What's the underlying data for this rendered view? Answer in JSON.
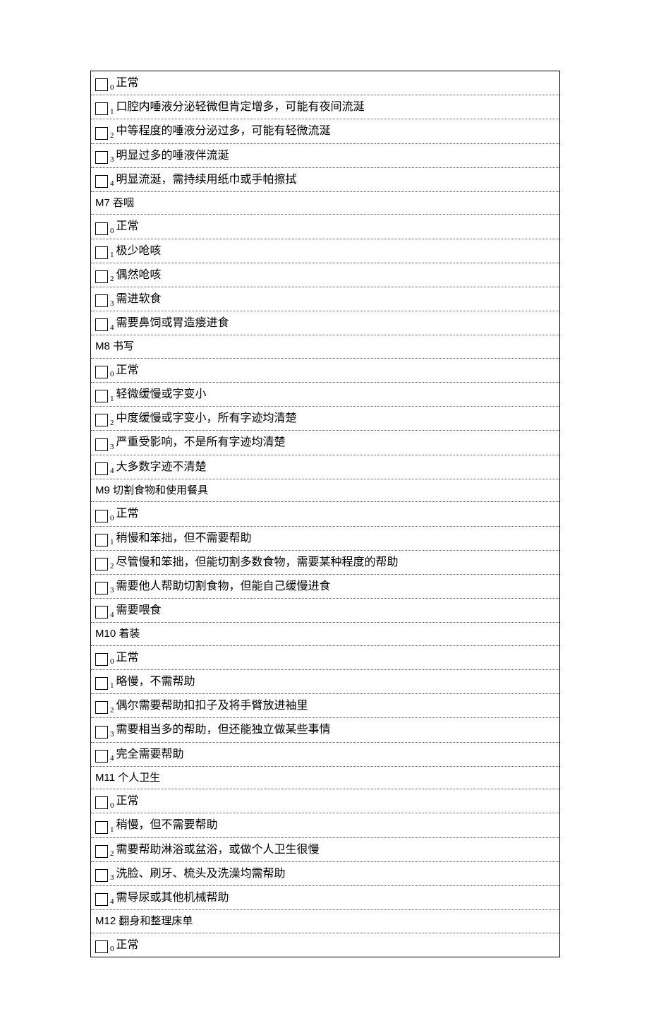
{
  "sections": [
    {
      "header": null,
      "options": [
        {
          "idx": "0",
          "text": "正常"
        },
        {
          "idx": "1",
          "text": "口腔内唾液分泌轻微但肯定增多，可能有夜间流涎"
        },
        {
          "idx": "2",
          "text": "中等程度的唾液分泌过多，可能有轻微流涎"
        },
        {
          "idx": "3",
          "text": "明显过多的唾液伴流涎"
        },
        {
          "idx": "4",
          "text": "明显流涎，需持续用纸巾或手帕擦拭"
        }
      ]
    },
    {
      "header": "M7  吞咽",
      "options": [
        {
          "idx": "0",
          "text": "正常"
        },
        {
          "idx": "1",
          "text": "极少呛咳"
        },
        {
          "idx": "2",
          "text": "偶然呛咳"
        },
        {
          "idx": "3",
          "text": "需进软食"
        },
        {
          "idx": "4",
          "text": "需要鼻饲或胃造瘘进食"
        }
      ]
    },
    {
      "header": "M8  书写",
      "options": [
        {
          "idx": "0",
          "text": "正常"
        },
        {
          "idx": "1",
          "text": "轻微缓慢或字变小"
        },
        {
          "idx": "2",
          "text": "中度缓慢或字变小，所有字迹均清楚"
        },
        {
          "idx": "3",
          "text": "严重受影响，不是所有字迹均清楚"
        },
        {
          "idx": "4",
          "text": "大多数字迹不清楚"
        }
      ]
    },
    {
      "header": "M9  切割食物和使用餐具",
      "options": [
        {
          "idx": "0",
          "text": "正常"
        },
        {
          "idx": "1",
          "text": "稍慢和笨拙，但不需要帮助"
        },
        {
          "idx": "2",
          "text": "尽管慢和笨拙，但能切割多数食物，需要某种程度的帮助"
        },
        {
          "idx": "3",
          "text": "需要他人帮助切割食物，但能自己缓慢进食"
        },
        {
          "idx": "4",
          "text": "需要喂食"
        }
      ]
    },
    {
      "header": "M10  着装",
      "options": [
        {
          "idx": "0",
          "text": "正常"
        },
        {
          "idx": "1",
          "text": "略慢，不需帮助"
        },
        {
          "idx": "2",
          "text": "偶尔需要帮助扣扣子及将手臂放进袖里"
        },
        {
          "idx": "3",
          "text": "需要相当多的帮助，但还能独立做某些事情"
        },
        {
          "idx": "4",
          "text": "完全需要帮助"
        }
      ]
    },
    {
      "header": "M11  个人卫生",
      "options": [
        {
          "idx": "0",
          "text": "正常"
        },
        {
          "idx": "1",
          "text": "稍慢，但不需要帮助"
        },
        {
          "idx": "2",
          "text": "需要帮助淋浴或盆浴，或做个人卫生很慢"
        },
        {
          "idx": "3",
          "text": "洗脸、刷牙、梳头及洗澡均需帮助"
        },
        {
          "idx": "4",
          "text": "需导尿或其他机械帮助"
        }
      ]
    },
    {
      "header": "M12  翻身和整理床单",
      "options": [
        {
          "idx": "0",
          "text": "正常"
        }
      ]
    }
  ]
}
